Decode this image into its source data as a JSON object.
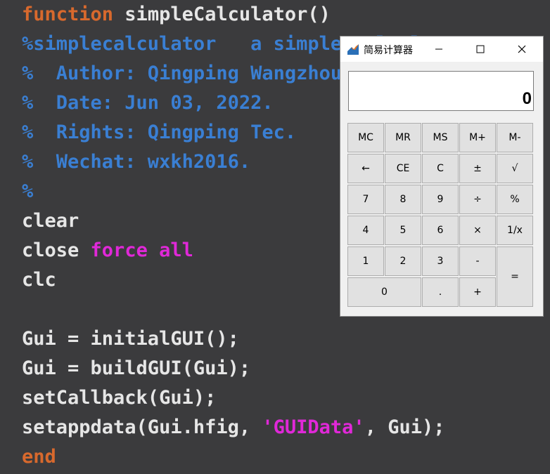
{
  "editor": {
    "lines": [
      {
        "parts": [
          {
            "t": "function",
            "c": "kw"
          },
          {
            "t": " simpleCalculator()",
            "c": "tx"
          }
        ]
      },
      {
        "parts": [
          {
            "t": "%simplecalculator   a simple calculator",
            "c": "cm"
          }
        ]
      },
      {
        "parts": [
          {
            "t": "%  Author: Qingping Wangzhou",
            "c": "cm"
          }
        ]
      },
      {
        "parts": [
          {
            "t": "%  Date: Jun 03, 2022.",
            "c": "cm"
          }
        ]
      },
      {
        "parts": [
          {
            "t": "%  Rights: Qingping Tec.",
            "c": "cm"
          }
        ]
      },
      {
        "parts": [
          {
            "t": "%  Wechat: wxkh2016.",
            "c": "cm"
          }
        ]
      },
      {
        "parts": [
          {
            "t": "%",
            "c": "cm"
          }
        ]
      },
      {
        "parts": [
          {
            "t": "clear",
            "c": "tx"
          }
        ]
      },
      {
        "parts": [
          {
            "t": "close ",
            "c": "tx"
          },
          {
            "t": "force all",
            "c": "mg"
          }
        ]
      },
      {
        "parts": [
          {
            "t": "clc",
            "c": "tx"
          }
        ]
      },
      {
        "parts": [
          {
            "t": "",
            "c": "tx"
          }
        ]
      },
      {
        "parts": [
          {
            "t": "Gui = initialGUI();",
            "c": "tx"
          }
        ]
      },
      {
        "parts": [
          {
            "t": "Gui = buildGUI(Gui);",
            "c": "tx"
          }
        ]
      },
      {
        "parts": [
          {
            "t": "setCallback(Gui);",
            "c": "tx"
          }
        ]
      },
      {
        "parts": [
          {
            "t": "setappdata(Gui.hfig, ",
            "c": "tx"
          },
          {
            "t": "'GUIData'",
            "c": "mg"
          },
          {
            "t": ", Gui);",
            "c": "tx"
          }
        ]
      },
      {
        "parts": [
          {
            "t": "end",
            "c": "kw"
          }
        ]
      }
    ]
  },
  "calculator": {
    "title": "简易计算器",
    "display_value": "0",
    "keys": {
      "mc": "MC",
      "mr": "MR",
      "ms": "MS",
      "mplus": "M+",
      "mminus": "M-",
      "back": "←",
      "ce": "CE",
      "c": "C",
      "plusminus": "±",
      "sqrt": "√",
      "k7": "7",
      "k8": "8",
      "k9": "9",
      "div": "÷",
      "pct": "%",
      "k4": "4",
      "k5": "5",
      "k6": "6",
      "mul": "×",
      "recip": "1/x",
      "k1": "1",
      "k2": "2",
      "k3": "3",
      "sub": "-",
      "eq": "=",
      "k0": "0",
      "dot": ".",
      "add": "+"
    }
  }
}
